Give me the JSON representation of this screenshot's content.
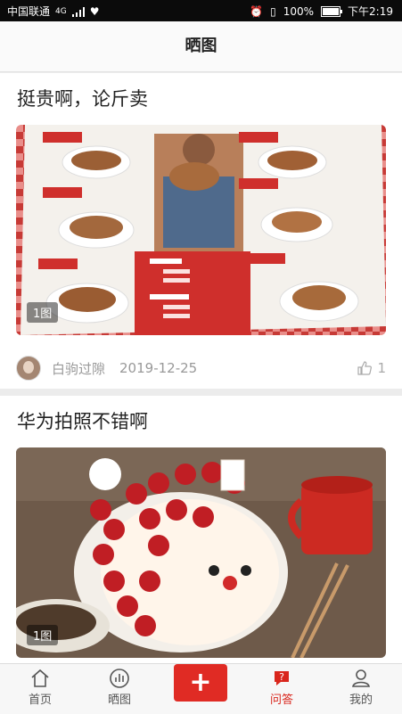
{
  "status_bar": {
    "carrier": "中国联通",
    "network": "4G",
    "battery": "100%",
    "time": "下午2:19"
  },
  "header": {
    "title": "晒图"
  },
  "posts": [
    {
      "title": "挺贵啊，论斤卖",
      "image_count_label": "1图",
      "author": "白驹过隙",
      "date": "2019-12-25",
      "likes": "1",
      "photo_text": {
        "items": [
          "牛肋排骨",
          "牛扇子骨",
          "牛脖骨",
          "牛肉骨",
          "牛腩骨",
          "牛扇子骨",
          "牛扇子骨肉",
          "牛拐骨"
        ],
        "prices": [
          "¥140",
          "¥79",
          "¥76",
          "¥63",
          "¥60",
          "¥89",
          "¥79",
          "¥69",
          "¥66",
          "129",
          "119",
          "29",
          "26",
          "¥89",
          "¥76"
        ]
      }
    },
    {
      "title": "华为拍照不错啊",
      "image_count_label": "1图"
    }
  ],
  "tabbar": {
    "items": [
      {
        "label": "首页",
        "icon": "home-icon",
        "active": false
      },
      {
        "label": "晒图",
        "icon": "chart-icon",
        "active": false
      },
      {
        "label": "+",
        "icon": "add-icon",
        "active": false
      },
      {
        "label": "问答",
        "icon": "question-bubble-icon",
        "active": true
      },
      {
        "label": "我的",
        "icon": "user-icon",
        "active": false
      }
    ]
  },
  "colors": {
    "accent": "#d9261c",
    "add_button": "#e02b24",
    "menu_red": "#cf2f2c"
  }
}
